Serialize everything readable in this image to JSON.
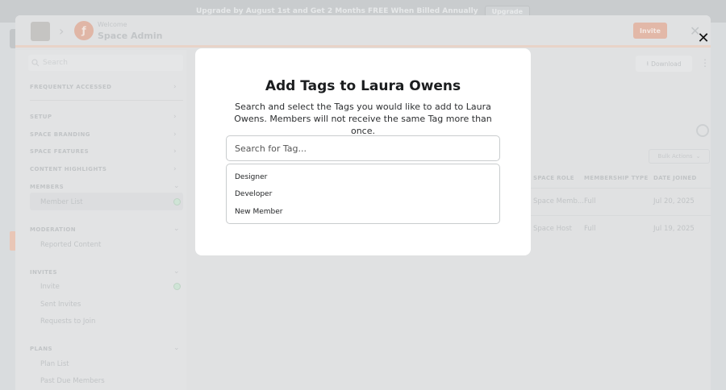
{
  "promo": {
    "text": "Upgrade by August 1st and Get 2 Months FREE When Billed Annually",
    "button": "Upgrade"
  },
  "header": {
    "welcome": "Welcome",
    "title": "Space Admin",
    "invite_label": "Invite",
    "brand_initial": "ƒ"
  },
  "sidebar": {
    "search_placeholder": "Search",
    "sections": {
      "frequently_accessed": "FREQUENTLY ACCESSED",
      "setup": "SETUP",
      "space_branding": "SPACE BRANDING",
      "space_features": "SPACE FEATURES",
      "content_highlights": "CONTENT HIGHLIGHTS",
      "members": "MEMBERS",
      "moderation": "MODERATION",
      "invites": "INVITES",
      "plans": "PLANS"
    },
    "items": {
      "member_list": "Member List",
      "reported_content": "Reported Content",
      "invite": "Invite",
      "sent_invites": "Sent Invites",
      "requests_to_join": "Requests to Join",
      "plan_list": "Plan List",
      "past_due_members": "Past Due Members"
    }
  },
  "content": {
    "download_label": "Download",
    "bulk_actions_label": "Bulk Actions",
    "columns": {
      "space_role": "SPACE ROLE",
      "membership_type": "MEMBERSHIP TYPE",
      "date_joined": "DATE JOINED"
    },
    "rows": [
      {
        "space_role": "Space Memb...",
        "membership_type": "Full",
        "date_joined": "Jul 20, 2025"
      },
      {
        "space_role": "Space Host",
        "membership_type": "Full",
        "date_joined": "Jul 19, 2025"
      }
    ]
  },
  "modal": {
    "title": "Add Tags to Laura Owens",
    "description": "Search and select the Tags you would like to add to Laura Owens. Members will not receive the same Tag more than once.",
    "search_placeholder": "Search for Tag...",
    "tags": [
      "Designer",
      "Developer",
      "New Member"
    ]
  },
  "icons": {
    "close": "close-icon",
    "search": "search-icon",
    "chevron": "chevron-icon",
    "download": "download-icon",
    "kebab": "kebab-icon"
  }
}
